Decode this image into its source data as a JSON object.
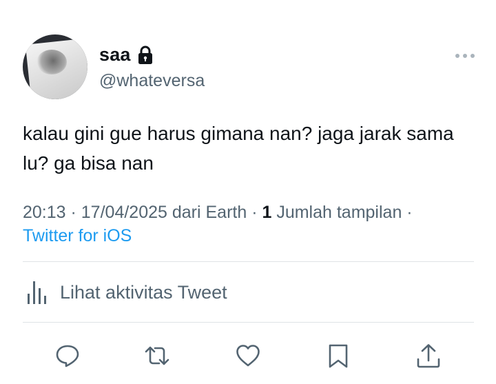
{
  "tweet": {
    "author": {
      "display_name": "saa",
      "handle": "@whateversa",
      "protected_icon": "lock-icon",
      "avatar": "profile-photo"
    },
    "text": "kalau gini gue harus gimana nan? jaga jarak sama lu? ga bisa nan",
    "meta": {
      "time": "20:13",
      "sep1": " · ",
      "date": "17/04/2025",
      "location": " dari Earth",
      "sep2": " · ",
      "views_count": "1",
      "views_label": " Jumlah tampilan",
      "sep3": " ·",
      "source": "Twitter for iOS"
    },
    "activity_label": "Lihat aktivitas Tweet",
    "actions": {
      "reply": "reply-icon",
      "retweet": "retweet-icon",
      "like": "like-icon",
      "bookmark": "bookmark-icon",
      "share": "share-icon"
    },
    "more": "more-icon"
  },
  "colors": {
    "text": "#0f1419",
    "secondary": "#536471",
    "link": "#1d9bf0",
    "divider": "#dfe3e6"
  }
}
